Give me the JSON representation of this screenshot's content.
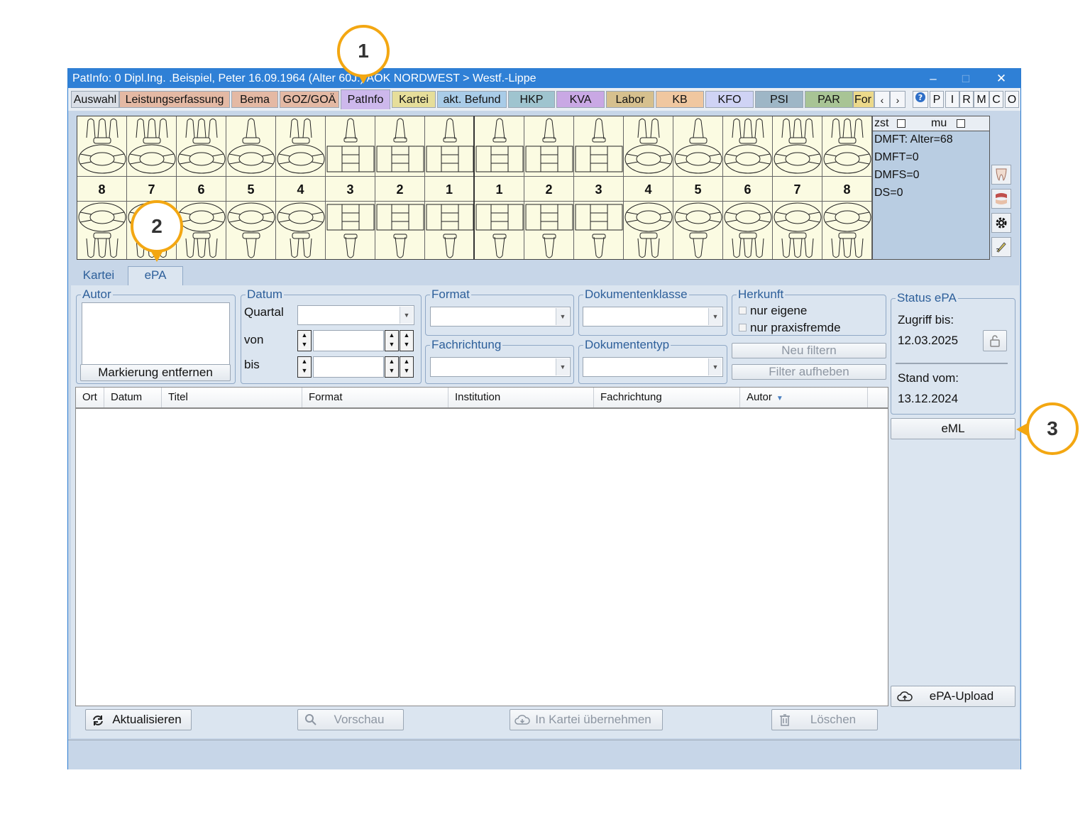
{
  "titlebar": {
    "text": "PatInfo: 0  Dipl.Ing. .Beispiel, Peter  16.09.1964 (Alter 60J.)  AOK NORDWEST > Westf.-Lippe",
    "minimize": "–",
    "maximize": "□",
    "close": "✕"
  },
  "main_tabs": [
    {
      "label": "Auswahl",
      "color": "#d9dee6"
    },
    {
      "label": "Leistungserfassung",
      "color": "#e4b9a4"
    },
    {
      "label": "Bema",
      "color": "#e4b9a4"
    },
    {
      "label": "GOZ/GOÄ",
      "color": "#e4b9a4"
    },
    {
      "label": "PatInfo",
      "color": "#cdb8ec"
    },
    {
      "label": "Kartei",
      "color": "#e6de9a"
    },
    {
      "label": "akt. Befund",
      "color": "#a9cce8"
    },
    {
      "label": "HKP",
      "color": "#9fc4cf"
    },
    {
      "label": "KVA",
      "color": "#c9a8e4"
    },
    {
      "label": "Labor",
      "color": "#d6c08e"
    },
    {
      "label": "KB",
      "color": "#f0c7a0"
    },
    {
      "label": "KFO",
      "color": "#cfd3f5"
    },
    {
      "label": "PSI",
      "color": "#9eb6c6"
    },
    {
      "label": "PAR",
      "color": "#a8c495"
    },
    {
      "label": "For",
      "color": "#ecd98a"
    }
  ],
  "tab_scroll": {
    "left": "‹",
    "right": "›"
  },
  "toolbar_letters": [
    "P",
    "I",
    "R",
    "M",
    "C",
    "O"
  ],
  "teeth_upper_numbers": [
    "8",
    "7",
    "6",
    "5",
    "4",
    "3",
    "2",
    "1",
    "1",
    "2",
    "3",
    "4",
    "5",
    "6",
    "7",
    "8"
  ],
  "dmft": {
    "zst": "zst",
    "mu": "mu",
    "lines": [
      "DMFT: Alter=68",
      "DMFT=0",
      "DMFS=0",
      "DS=0"
    ]
  },
  "panel_tabs": [
    "Kartei",
    "ePA"
  ],
  "autor": {
    "legend": "Autor",
    "button": "Markierung entfernen"
  },
  "datum": {
    "legend": "Datum",
    "quartal": "Quartal",
    "von": "von",
    "bis": "bis"
  },
  "format": {
    "legend": "Format"
  },
  "fachrichtung": {
    "legend": "Fachrichtung"
  },
  "dokumentenklasse": {
    "legend": "Dokumentenklasse"
  },
  "dokumententyp": {
    "legend": "Dokumententyp"
  },
  "herkunft": {
    "legend": "Herkunft",
    "opt1": "nur eigene",
    "opt2": "nur praxisfremde"
  },
  "filter": {
    "neu": "Neu filtern",
    "aufheben": "Filter aufheben"
  },
  "table": {
    "columns": [
      "Ort",
      "Datum",
      "Titel",
      "Format",
      "Institution",
      "Fachrichtung",
      "Autor"
    ]
  },
  "status_epa": {
    "legend": "Status ePA",
    "zugriff_label": "Zugriff bis:",
    "zugriff_value": "12.03.2025",
    "stand_label": "Stand vom:",
    "stand_value": "13.12.2024"
  },
  "buttons": {
    "eml": "eML",
    "upload": "ePA-Upload",
    "aktualisieren": "Aktualisieren",
    "vorschau": "Vorschau",
    "in_kartei": "In Kartei übernehmen",
    "loeschen": "Löschen"
  },
  "callouts": [
    "1",
    "2",
    "3"
  ],
  "colors": {
    "titlebar": "#2f80d6",
    "callout": "#f3a712",
    "panel": "#dbe5f0"
  }
}
